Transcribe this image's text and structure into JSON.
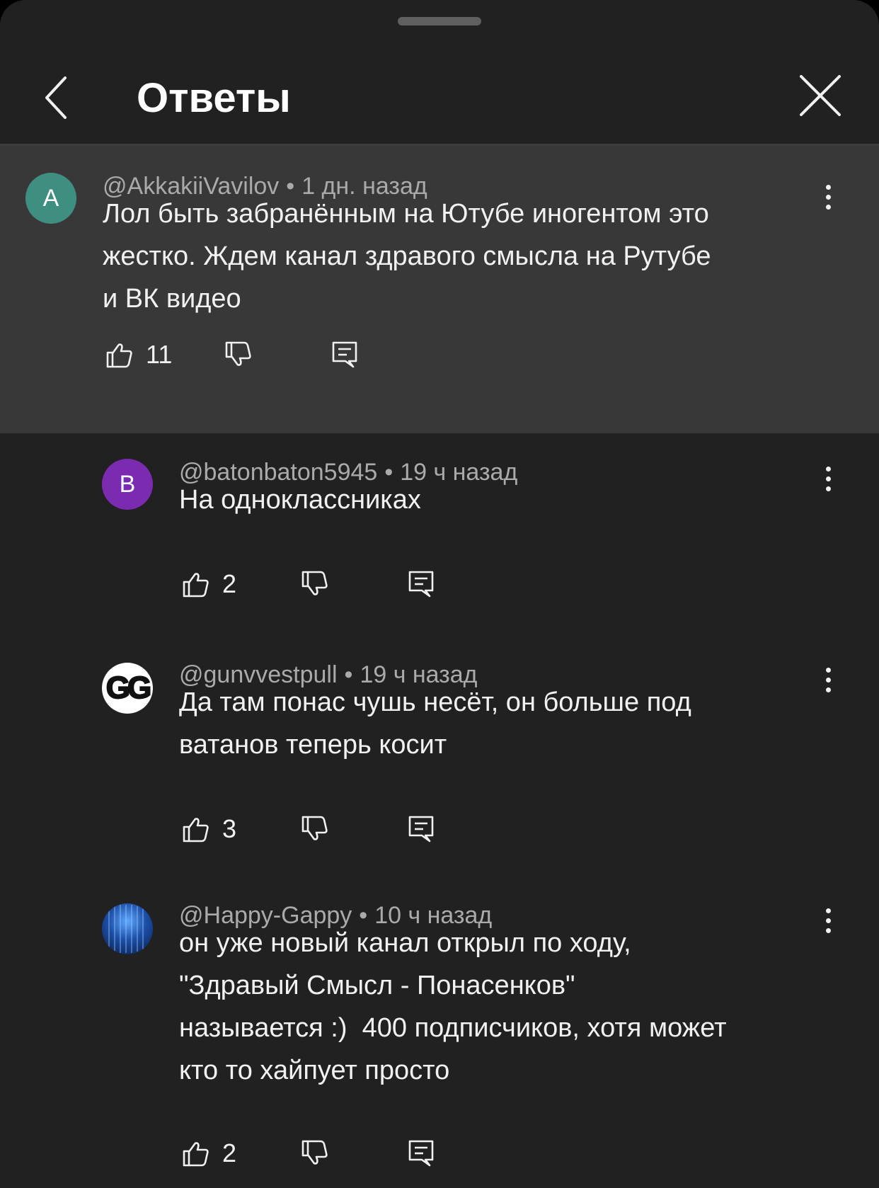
{
  "header": {
    "title": "Ответы"
  },
  "parent": {
    "avatar_letter": "A",
    "avatar_color": "#3f8f80",
    "author": "@AkkakiiVavilov",
    "separator": "•",
    "time": "1 дн. назад",
    "lines": [
      "Лол быть забранённым на Ютубе иногентом это",
      "жестко. Ждем канал здравого смысла на Рутубе",
      "и ВК видео"
    ],
    "likes": "11"
  },
  "replies": [
    {
      "avatar_letter": "B",
      "avatar_color": "#7b2bb0",
      "author": "@batonbaton5945",
      "separator": "•",
      "time": "19 ч назад",
      "lines": [
        "На одноклассниках"
      ],
      "likes": "2"
    },
    {
      "avatar_letter": "GG",
      "avatar_color": "#ffffff",
      "author": "@gunvvestpull",
      "separator": "•",
      "time": "19 ч назад",
      "lines": [
        "Да там понас чушь несёт, он больше под",
        "ватанов теперь косит"
      ],
      "likes": "3"
    },
    {
      "avatar_letter": "",
      "avatar_color": "#1d4fa8",
      "author": "@Happy-Gappy",
      "separator": "•",
      "time": "10 ч назад",
      "lines": [
        "он уже новый канал открыл по ходу,",
        "\"Здравый Смысл - Понасенков\"",
        "называется :)  400 подписчиков, хотя может",
        "кто то хайпует просто"
      ],
      "likes": "2"
    }
  ],
  "icons": {
    "back": "chevron-left-icon",
    "close": "close-icon",
    "like": "thumbs-up-icon",
    "dislike": "thumbs-down-icon",
    "reply": "comment-reply-icon",
    "more": "more-vertical-icon"
  }
}
